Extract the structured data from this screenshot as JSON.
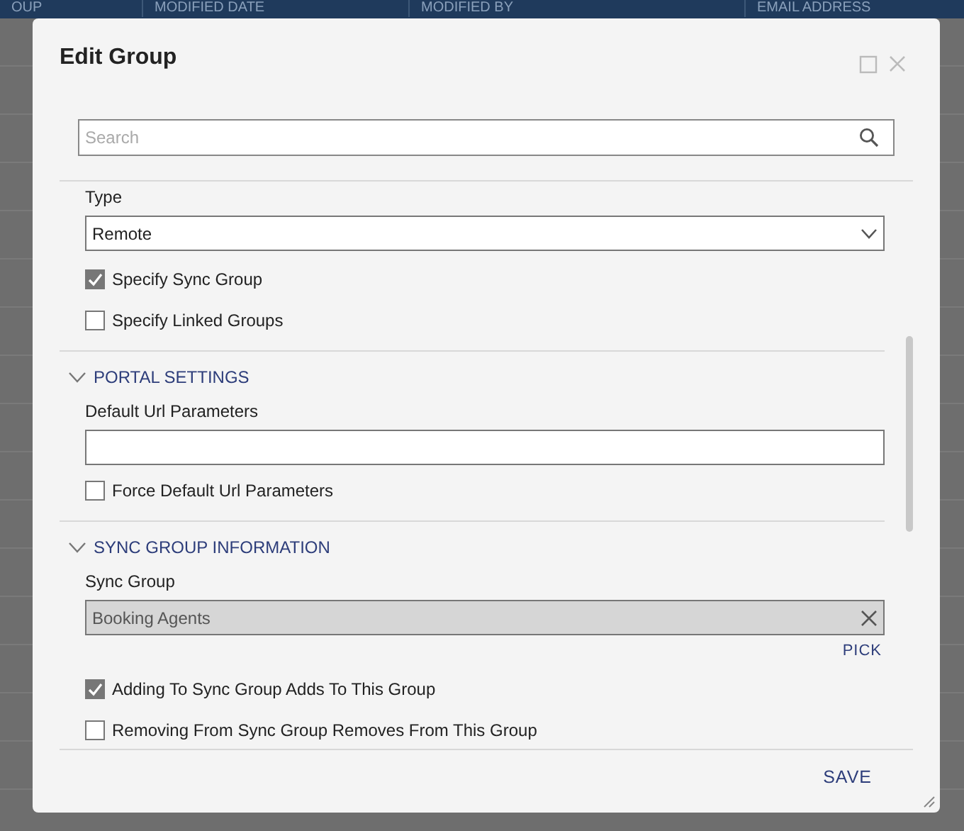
{
  "background_table": {
    "columns": [
      "OUP",
      "MODIFIED DATE",
      "MODIFIED BY",
      "EMAIL ADDRESS"
    ]
  },
  "dialog": {
    "title": "Edit Group",
    "search": {
      "placeholder": "Search"
    },
    "sections": [
      {
        "kind": "plain",
        "fields": [
          {
            "kind": "select",
            "label": "Type",
            "value": "Remote"
          },
          {
            "kind": "checkbox",
            "label": "Specify Sync Group",
            "checked": true
          },
          {
            "kind": "checkbox",
            "label": "Specify Linked Groups",
            "checked": false
          }
        ]
      },
      {
        "kind": "collapsible",
        "title": "PORTAL SETTINGS",
        "expanded": true,
        "fields": [
          {
            "kind": "text",
            "label": "Default Url Parameters"
          },
          {
            "kind": "checkbox",
            "label": "Force Default Url Parameters",
            "checked": false
          }
        ]
      },
      {
        "kind": "collapsible",
        "title": "SYNC GROUP INFORMATION",
        "expanded": true,
        "fields": [
          {
            "kind": "picker",
            "label": "Sync Group",
            "value": "Booking Agents",
            "action": "PICK"
          },
          {
            "kind": "checkbox",
            "label": "Adding To Sync Group Adds To This Group",
            "checked": true
          },
          {
            "kind": "checkbox",
            "label": "Removing From Sync Group Removes From This Group",
            "checked": false
          }
        ]
      }
    ],
    "save_button": "SAVE"
  }
}
